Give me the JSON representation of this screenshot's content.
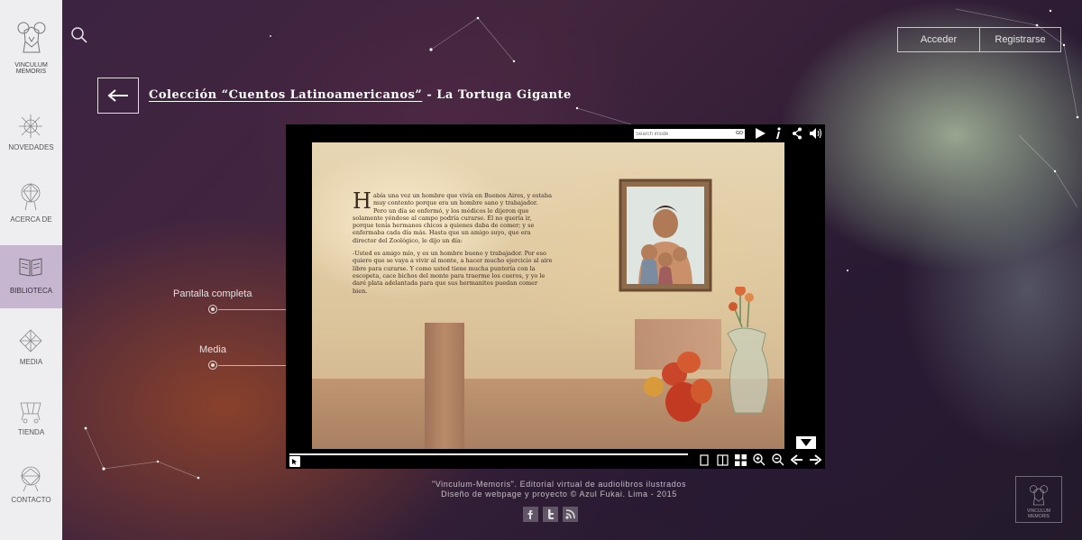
{
  "sidebar": {
    "logo_label": "VINCULUM MEMORIS",
    "items": [
      {
        "label": "NOVEDADES",
        "icon": "sparkle-icon"
      },
      {
        "label": "ACERCA DE",
        "icon": "network-icon"
      },
      {
        "label": "BIBLIOTECA",
        "icon": "book-icon",
        "active": true
      },
      {
        "label": "MEDIA",
        "icon": "media-icon"
      },
      {
        "label": "TIENDA",
        "icon": "shop-icon"
      },
      {
        "label": "CONTACTO",
        "icon": "contact-icon"
      }
    ]
  },
  "header": {
    "login_label": "Acceder",
    "register_label": "Registrarse"
  },
  "breadcrumb": {
    "collection": "Colección “Cuentos Latinoamericanos”",
    "separator": " - ",
    "title": "La Tortuga Gigante"
  },
  "side_options": {
    "fullscreen": "Pantalla completa",
    "media": "Media"
  },
  "viewer": {
    "search_placeholder": "Search inside",
    "go_label": "GO",
    "page_text": {
      "dropcap": "H",
      "paragraph1": "abía una vez un hombre que vivía en Buenos Aires, y estaba muy contento porque era un hombre sano y trabajador. Pero un día se enfermó, y los médicos le dijeron que solamente yéndose al campo podría curarse. Él no quería ir, porque tenía hermanos chicos a quienes daba de comer; y se enfermaba cada día más. Hasta que un amigo suyo, que era director del Zoológico, le dijo un día:",
      "paragraph2": "-Usted es amigo mío, y es un hombre bueno y trabajador. Por eso quiero que se vaya a vivir al monte, a hacer mucho ejercicio al aire libre para curarse. Y como usted tiene mucha puntería con la escopeta, cace bichos del monte para traerme los cueros, y yo le daré plata adelantada para que sus hermanitos puedan comer bien."
    }
  },
  "footer": {
    "line1": "\"Vinculum-Memoris\". Editorial virtual de audiolibros ilustrados",
    "line2": "Diseño de webpage y proyecto © Azul Fukai. Lima - 2015",
    "corner_logo_label": "VINCULUM MEMORIS"
  },
  "colors": {
    "sidebar_bg": "#eeedf0",
    "active_item_bg": "#c6b6d0",
    "viewer_bg": "#000000"
  }
}
